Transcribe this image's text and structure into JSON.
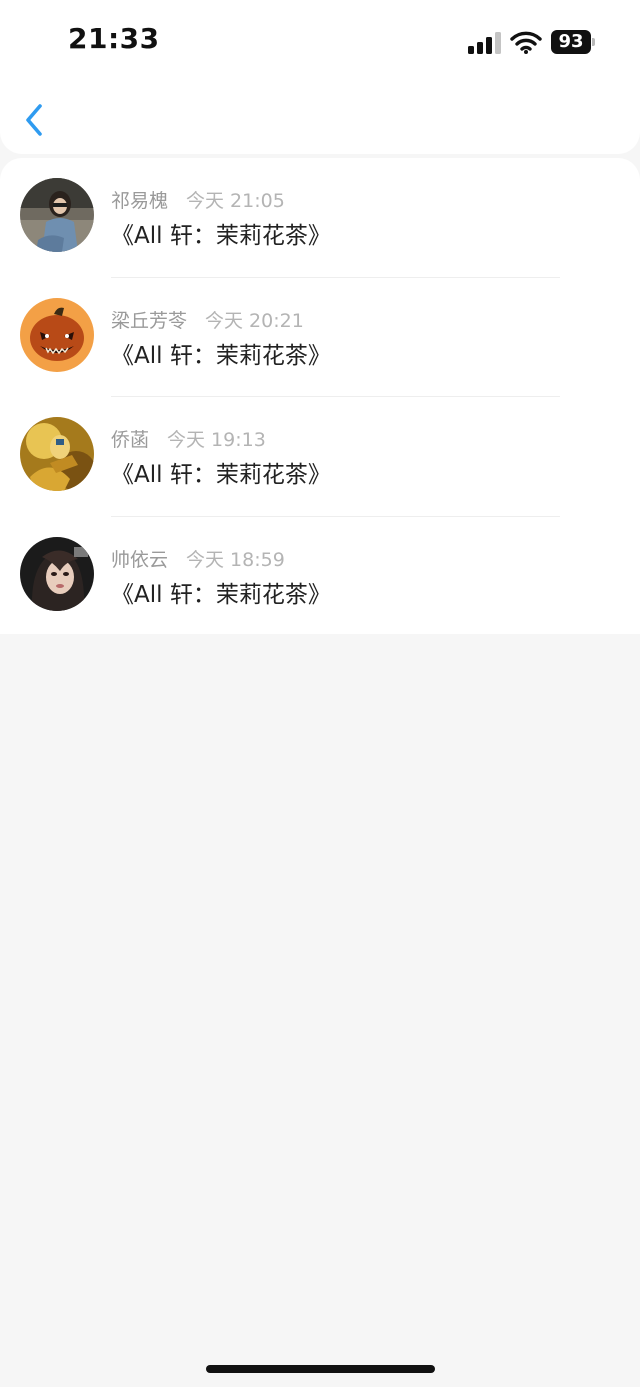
{
  "status_bar": {
    "time": "21:33",
    "battery": "93"
  },
  "nav": {
    "back_icon": "chevron-left-icon",
    "accent": "#2f9bf0"
  },
  "comments": [
    {
      "user": "祁易槐",
      "time": "今天 21:05",
      "text": "《All 轩：茉莉花茶》"
    },
    {
      "user": "梁丘芳苓",
      "time": "今天 20:21",
      "text": "《All 轩：茉莉花茶》"
    },
    {
      "user": "侨菡",
      "time": "今天 19:13",
      "text": "《All 轩：茉莉花茶》"
    },
    {
      "user": "帅依云",
      "time": "今天 18:59",
      "text": "《All 轩：茉莉花茶》"
    }
  ]
}
